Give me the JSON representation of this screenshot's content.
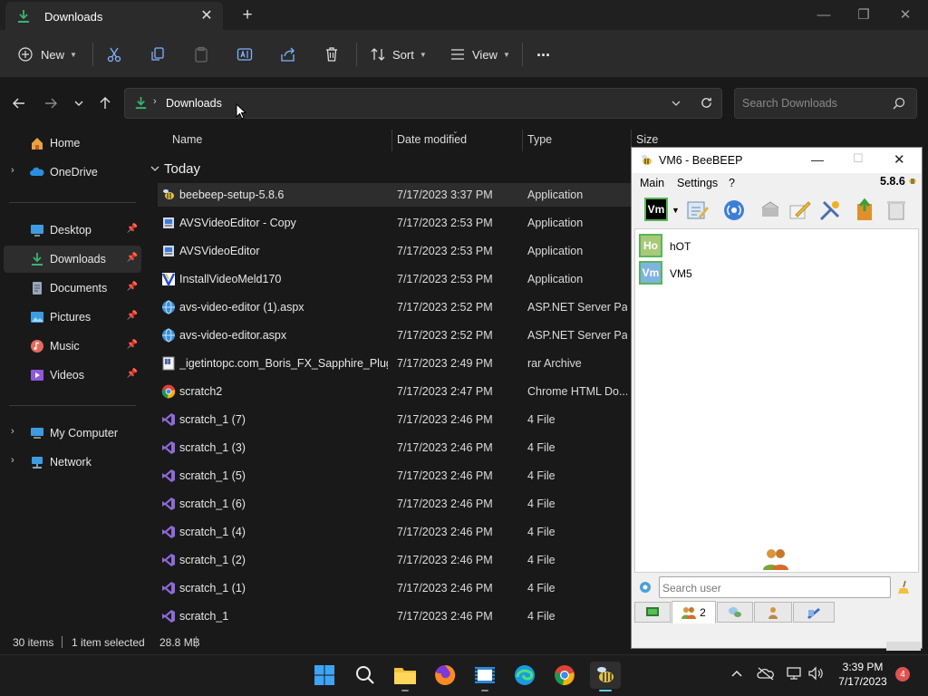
{
  "explorer": {
    "tab_title": "Downloads",
    "toolbar": {
      "new_label": "New",
      "sort_label": "Sort",
      "view_label": "View",
      "more_label": "..."
    },
    "breadcrumb": "Downloads",
    "search_placeholder": "Search Downloads",
    "sidebar": {
      "home": "Home",
      "onedrive": "OneDrive",
      "desktop": "Desktop",
      "downloads": "Downloads",
      "documents": "Documents",
      "pictures": "Pictures",
      "music": "Music",
      "videos": "Videos",
      "my_computer": "My Computer",
      "network": "Network"
    },
    "columns": {
      "name": "Name",
      "date": "Date modified",
      "type": "Type",
      "size": "Size"
    },
    "group_header": "Today",
    "files": [
      {
        "name": "beebeep-setup-5.8.6",
        "date": "7/17/2023 3:37 PM",
        "type": "Application",
        "icon": "beebeep-app-icon"
      },
      {
        "name": "AVSVideoEditor - Copy",
        "date": "7/17/2023 2:53 PM",
        "type": "Application",
        "icon": "installer-app-icon"
      },
      {
        "name": "AVSVideoEditor",
        "date": "7/17/2023 2:53 PM",
        "type": "Application",
        "icon": "installer-app-icon"
      },
      {
        "name": "InstallVideoMeld170",
        "date": "7/17/2023 2:53 PM",
        "type": "Application",
        "icon": "videomeld-app-icon"
      },
      {
        "name": "avs-video-editor (1).aspx",
        "date": "7/17/2023 2:52 PM",
        "type": "ASP.NET Server Pa...",
        "icon": "globe-icon"
      },
      {
        "name": "avs-video-editor.aspx",
        "date": "7/17/2023 2:52 PM",
        "type": "ASP.NET Server Pa...",
        "icon": "globe-icon"
      },
      {
        "name": "_igetintopc.com_Boris_FX_Sapphire_Plug...",
        "date": "7/17/2023 2:49 PM",
        "type": "rar Archive",
        "icon": "archive-icon"
      },
      {
        "name": "scratch2",
        "date": "7/17/2023 2:47 PM",
        "type": "Chrome HTML Do...",
        "icon": "chrome-icon"
      },
      {
        "name": "scratch_1 (7)",
        "date": "7/17/2023 2:46 PM",
        "type": "4 File",
        "icon": "visual-studio-icon"
      },
      {
        "name": "scratch_1 (3)",
        "date": "7/17/2023 2:46 PM",
        "type": "4 File",
        "icon": "visual-studio-icon"
      },
      {
        "name": "scratch_1 (5)",
        "date": "7/17/2023 2:46 PM",
        "type": "4 File",
        "icon": "visual-studio-icon"
      },
      {
        "name": "scratch_1 (6)",
        "date": "7/17/2023 2:46 PM",
        "type": "4 File",
        "icon": "visual-studio-icon"
      },
      {
        "name": "scratch_1 (4)",
        "date": "7/17/2023 2:46 PM",
        "type": "4 File",
        "icon": "visual-studio-icon"
      },
      {
        "name": "scratch_1 (2)",
        "date": "7/17/2023 2:46 PM",
        "type": "4 File",
        "icon": "visual-studio-icon"
      },
      {
        "name": "scratch_1 (1)",
        "date": "7/17/2023 2:46 PM",
        "type": "4 File",
        "icon": "visual-studio-icon"
      },
      {
        "name": "scratch_1",
        "date": "7/17/2023 2:46 PM",
        "type": "4 File",
        "icon": "visual-studio-icon"
      }
    ],
    "status": {
      "item_count": "30 items",
      "selection": "1 item selected",
      "size": "28.8 MB"
    }
  },
  "beebeep": {
    "title": "VM6 - BeeBEEP",
    "version": "5.8.6",
    "menu": {
      "main": "Main",
      "settings": "Settings",
      "help": "?"
    },
    "toolbar_status": "Vm",
    "users": [
      {
        "initials": "Ho",
        "name": "hOT",
        "color": "#a8c97a"
      },
      {
        "initials": "Vm",
        "name": "VM5",
        "color": "#7fb3e0"
      }
    ],
    "search_placeholder": "Search user",
    "users_tab_count": "2"
  },
  "taskbar": {
    "time": "3:39 PM",
    "date": "7/17/2023",
    "notification_count": "4"
  },
  "colors": {
    "accent": "#60cdff",
    "explorer_bg": "#191919",
    "selected_row": "#2d2d2d",
    "notification_badge": "#e05252"
  }
}
